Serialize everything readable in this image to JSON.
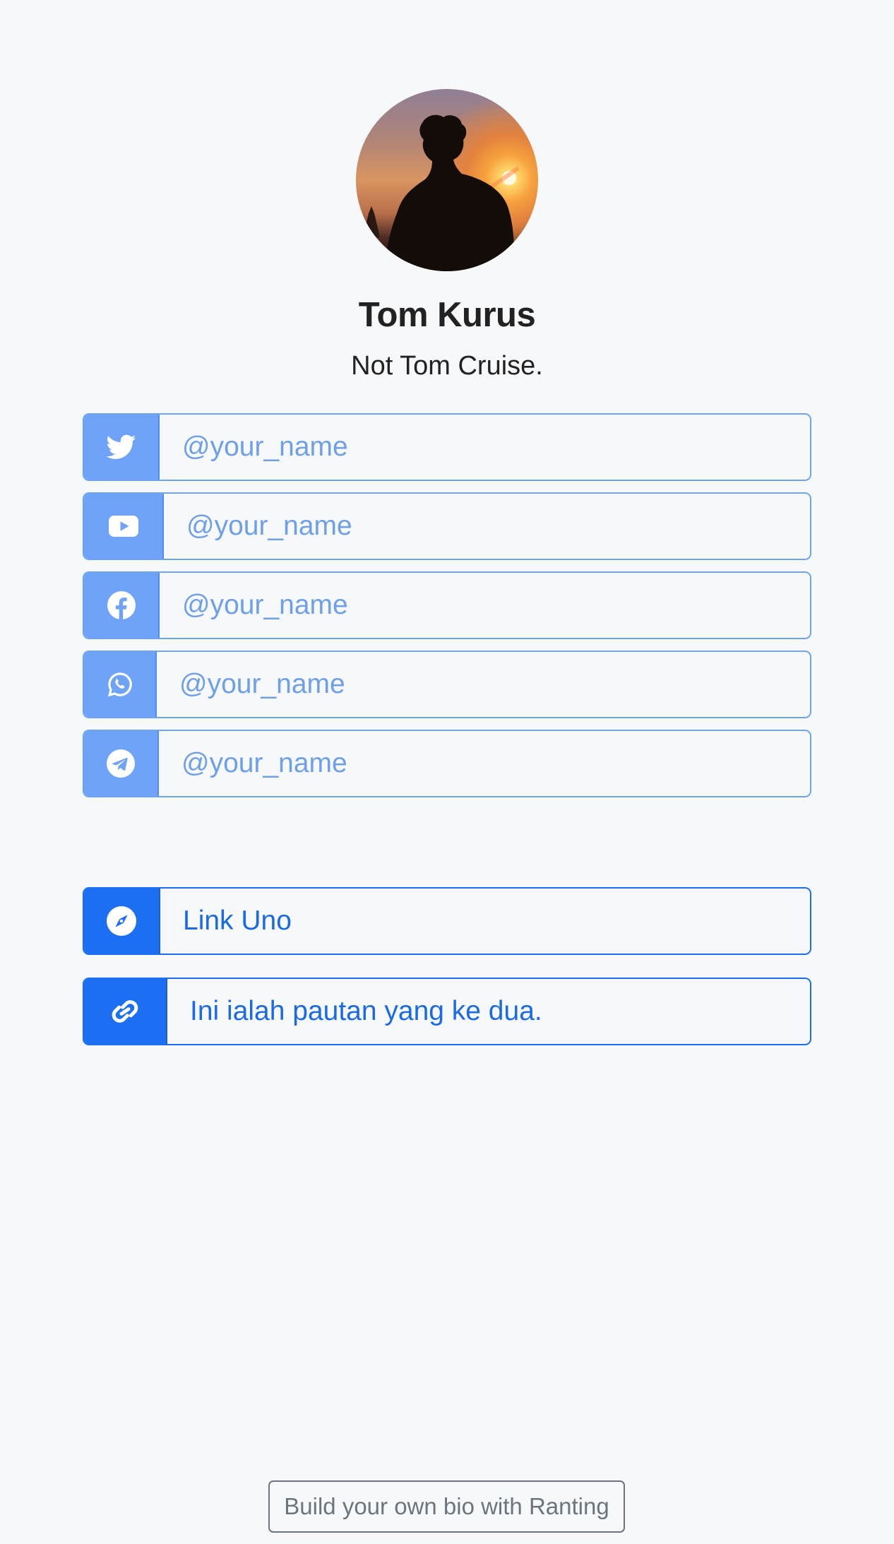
{
  "profile": {
    "name": "Tom Kurus",
    "tagline": "Not Tom Cruise."
  },
  "social_links": [
    {
      "icon": "twitter-icon",
      "label": "@your_name"
    },
    {
      "icon": "youtube-icon",
      "label": "@your_name"
    },
    {
      "icon": "facebook-icon",
      "label": "@your_name"
    },
    {
      "icon": "whatsapp-icon",
      "label": "@your_name"
    },
    {
      "icon": "telegram-icon",
      "label": "@your_name"
    }
  ],
  "custom_links": [
    {
      "icon": "compass-icon",
      "label": "Link Uno"
    },
    {
      "icon": "link-icon",
      "label": "Ini ialah pautan yang ke dua."
    }
  ],
  "footer": {
    "button_label": "Build your own bio with Ranting"
  },
  "colors": {
    "background": "#f7f8fa",
    "social_accent": "#6fa3f8",
    "link_accent": "#1c6ff2",
    "footer_border": "#6c757d"
  }
}
